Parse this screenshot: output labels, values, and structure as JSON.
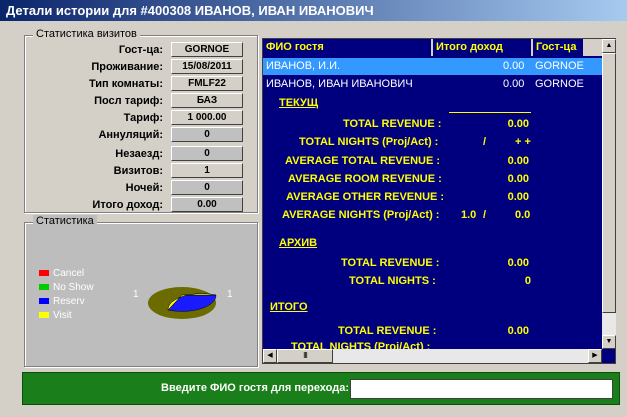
{
  "window": {
    "title": "Детали истории для #400308 ИВАНОВ, ИВАН ИВАНОВИЧ"
  },
  "visits_group": {
    "title": "Статистика визитов",
    "rows": [
      {
        "label": "Гост-ца:",
        "value": "GORNOE"
      },
      {
        "label": "Проживание:",
        "value": "15/08/2011"
      },
      {
        "label": "Тип комнаты:",
        "value": "FMLF22"
      },
      {
        "label": "Посл тариф:",
        "value": "БАЗ"
      },
      {
        "label": "Тариф:",
        "value": "1 000.00"
      },
      {
        "label": "Аннуляций:",
        "value": "0"
      },
      {
        "label": "Незаезд:",
        "value": "0"
      },
      {
        "label": "Визитов:",
        "value": "1"
      },
      {
        "label": "Ночей:",
        "value": "0"
      },
      {
        "label": "Итого доход:",
        "value": "0.00"
      }
    ]
  },
  "stats_group": {
    "title": "Статистика",
    "legend": [
      {
        "label": "Cancel",
        "color": "#ff0000"
      },
      {
        "label": "No Show",
        "color": "#00cc00"
      },
      {
        "label": "Reserv",
        "color": "#0000ff"
      },
      {
        "label": "Visit",
        "color": "#ffff00"
      }
    ],
    "pie_left_label": "1",
    "pie_right_label": "1",
    "chart_data": {
      "type": "pie",
      "categories": [
        "Reserv",
        "Visit"
      ],
      "values": [
        1,
        1
      ]
    }
  },
  "grid": {
    "headers": [
      "ФИО гостя",
      "Итого доход",
      "Гост-ца"
    ],
    "rows": [
      {
        "name": "ИВАНОВ, И.И.",
        "income": "0.00",
        "hotel": "GORNOE",
        "selected": true
      },
      {
        "name": "ИВАНОВ, ИВАН ИВАНОВИЧ",
        "income": "0.00",
        "hotel": "GORNOE",
        "selected": false
      }
    ],
    "current": {
      "title": "ТЕКУЩ",
      "total_revenue_label": "TOTAL REVENUE :",
      "total_revenue": "0.00",
      "total_nights_label": "TOTAL NIGHTS (Proj/Act) :",
      "total_nights_slash": "/",
      "total_nights_value": "+ +",
      "avg_total_label": "AVERAGE TOTAL REVENUE :",
      "avg_total": "0.00",
      "avg_room_label": "AVERAGE ROOM REVENUE :",
      "avg_room": "0.00",
      "avg_other_label": "AVERAGE OTHER REVENUE :",
      "avg_other": "0.00",
      "avg_nights_label": "AVERAGE NIGHTS (Proj/Act) :",
      "avg_nights_proj": "1.0",
      "avg_nights_slash": "/",
      "avg_nights_act": "0.0"
    },
    "archive": {
      "title": "АРХИВ",
      "total_revenue_label": "TOTAL REVENUE :",
      "total_revenue": "0.00",
      "total_nights_label": "TOTAL NIGHTS :",
      "total_nights": "0"
    },
    "total": {
      "title": "ИТОГО",
      "total_revenue_label": "TOTAL REVENUE :",
      "total_revenue": "0.00",
      "cut_label": "TOTAL NIGHTS (Proj/Act) :"
    },
    "hscroll_thumb": "III"
  },
  "bottom": {
    "label": "Введите ФИО гостя для перехода:",
    "input_value": ""
  }
}
